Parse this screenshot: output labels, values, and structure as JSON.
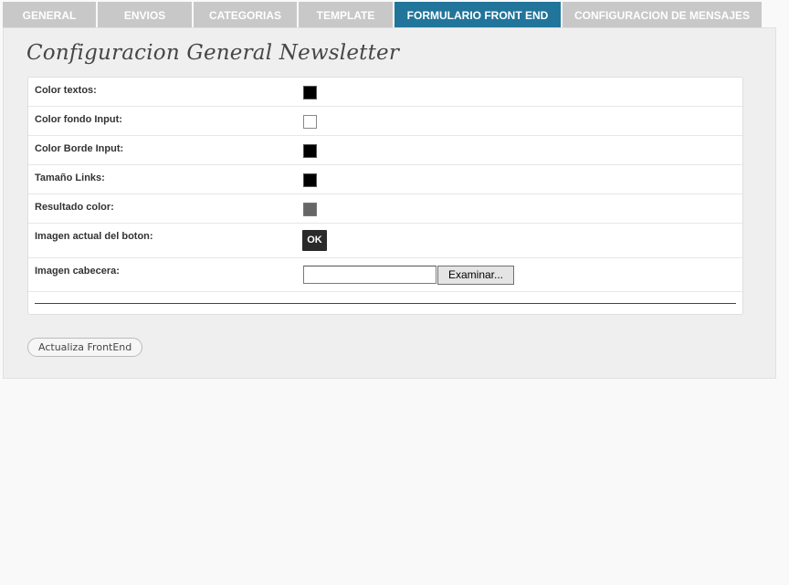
{
  "tabs": [
    {
      "label": "GENERAL"
    },
    {
      "label": "ENVIOS"
    },
    {
      "label": "CATEGORIAS"
    },
    {
      "label": "TEMPLATE"
    },
    {
      "label": "FORMULARIO FRONT END",
      "active": true
    },
    {
      "label": "CONFIGURACION DE MENSAJES"
    }
  ],
  "page": {
    "title": "Configuracion General Newsletter"
  },
  "form": {
    "rows": [
      {
        "label": "Color textos:",
        "color": "#000000"
      },
      {
        "label": "Color fondo Input:",
        "color": "#ffffff"
      },
      {
        "label": "Color Borde Input:",
        "color": "#000000"
      },
      {
        "label": "Tamaño Links:",
        "color": "#000000"
      },
      {
        "label": "Resultado color:",
        "color": "#666666"
      },
      {
        "label": "Imagen actual del boton:",
        "button_text": "OK"
      },
      {
        "label": "Imagen cabecera:",
        "file_value": "",
        "browse_label": "Examinar..."
      }
    ],
    "submit_label": "Actualiza FrontEnd"
  },
  "colors": {
    "active_tab": "#21759b",
    "inactive_tab": "#c8c8c8"
  }
}
